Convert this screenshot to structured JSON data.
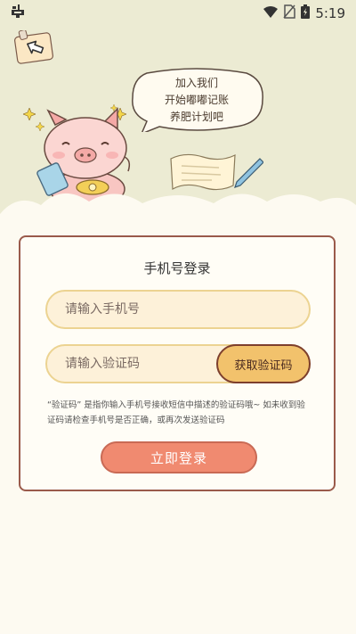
{
  "status_bar": {
    "app_icon": "bug-icon",
    "time": "5:19",
    "icons": [
      "wifi-icon",
      "no-sim-icon",
      "battery-icon"
    ]
  },
  "header": {
    "back_icon": "arrow-left-icon"
  },
  "speech_bubble": {
    "line1": "加入我们",
    "line2": "开始嘟嘟记账",
    "line3": "养肥计划吧"
  },
  "login_card": {
    "title": "手机号登录",
    "phone_placeholder": "请输入手机号",
    "code_placeholder": "请输入验证码",
    "get_code_label": "获取验证码",
    "hint": "“验证码” 是指你输入手机号接收短信中描述的验证码哦~ 如未收到验证码请检查手机号是否正确，或再次发送验证码",
    "login_label": "立即登录"
  },
  "colors": {
    "top_background": "#ecebd3",
    "page_background": "#fdfaf1",
    "card_border": "#9a5a4b",
    "input_fill": "#fdf1d9",
    "input_border": "#ecd391",
    "code_button": "#f2c26c",
    "login_button": "#f08a70"
  }
}
